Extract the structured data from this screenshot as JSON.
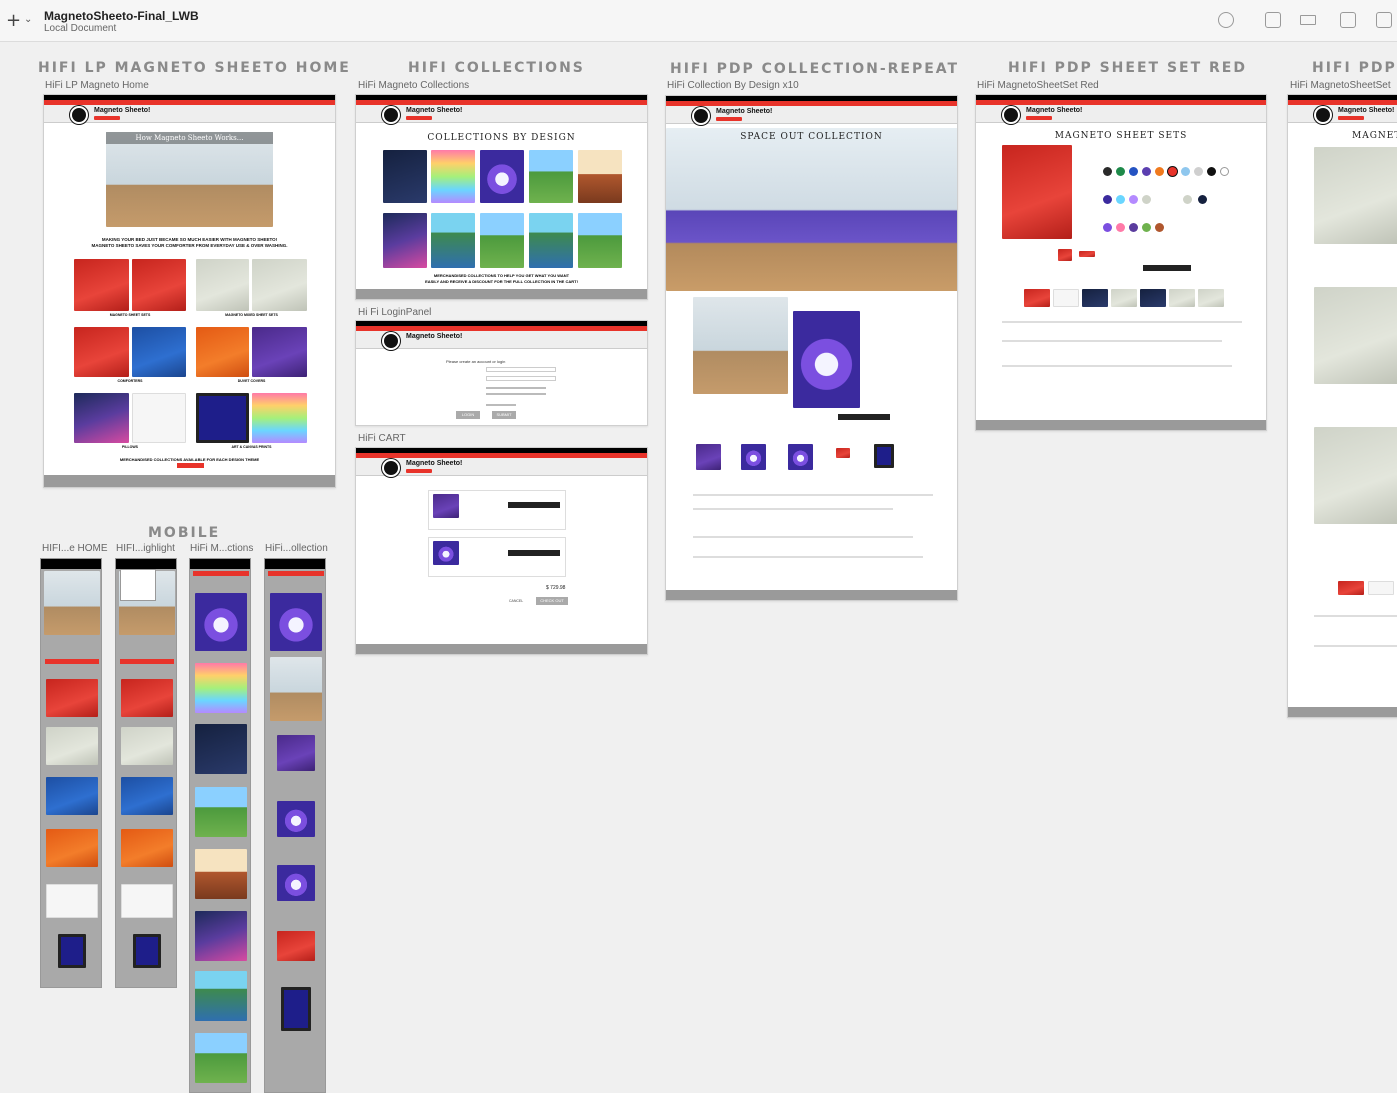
{
  "titlebar": {
    "doc_title": "MagnetoSheeto-Final_LWB",
    "doc_subtitle": "Local Document",
    "add_glyph": "+",
    "chevron_glyph": "⌄"
  },
  "sections": {
    "hifi_lp": "HIFI LP MAGNETO SHEETO HOME",
    "hifi_collections": "HIFI COLLECTIONS",
    "hifi_pdp_repeat": "HIFI PDP COLLECTION-REPEAT",
    "hifi_pdp_red": "HIFI PDP SHEET SET RED",
    "hifi_pdp_cut": "HIFI PDP",
    "mobile": "MOBILE"
  },
  "frame_labels": {
    "lp": "HiFi LP Magneto Home",
    "collections": "HiFi Magneto Collections",
    "pdp_repeat": "HiFi Collection By Design x10",
    "pdp_red": "HiFi MagnetoSheetSet Red",
    "pdp_cut": "HiFi MagnetoSheetSet",
    "login": "Hi Fi LoginPanel",
    "cart": "HiFi CART",
    "m1": "HIFI...e HOME",
    "m2": "HIFI...ighlight",
    "m3": "HiFi M...ctions",
    "m4": "HiFi...ollection"
  },
  "frame_content": {
    "brand": "Magneto Sheeto!",
    "lp_banner": "How Magneto Sheeto Works...",
    "lp_tagline_1": "MAKING YOUR BED JUST BECAME SO MUCH EASIER WITH MAGNETO SHEETO!",
    "lp_tagline_2": "MAGNETO SHEETO SAVES YOUR COMFORTER FROM EVERYDAY USE & OVER WASHING.",
    "lp_cat_1": "MAGNETO SHEET SETS",
    "lp_cat_2": "MAGNETO MIXED SHEET SETS",
    "lp_cat_3": "COMFORTERS",
    "lp_cat_4": "DUVET COVERS",
    "lp_cat_5": "PILLOWS",
    "lp_cat_6": "ART & CANVAS PRINTS",
    "lp_footer_note": "MERCHANDISED COLLECTIONS AVAILABLE FOR EACH DESIGN THEME",
    "coll_title": "COLLECTIONS BY DESIGN",
    "coll_note_1": "MERCHANDISED COLLECTIONS TO HELP YOU GET WHAT YOU WANT",
    "coll_note_2": "EASILY AND RECEIVE A DISCOUNT FOR THE FULL COLLECTION IN THE CART!",
    "pdp_repeat_title": "SPACE OUT COLLECTION",
    "pdp_red_title": "MAGNETO SHEET SETS",
    "pdp_cut_title": "MAGNET",
    "login_prompt": "Please create an account or login",
    "login_button": "LOGIN",
    "submit_button": "SUBMIT",
    "cart_checkout": "CHECK OUT",
    "cart_cancel": "CANCEL",
    "cart_total": "$ 729.98",
    "mobile_tag": "COLLECTIONS"
  },
  "colors": {
    "accent_red": "#e8332a",
    "header_black": "#000000",
    "canvas_bg": "#f0f0f0"
  },
  "icons": {
    "add": "plus-icon",
    "chevron": "chevron-down-icon",
    "toolbar": [
      "prototype-icon",
      "share-icon",
      "filter-icon",
      "zoom-fit-icon",
      "crop-icon"
    ]
  }
}
